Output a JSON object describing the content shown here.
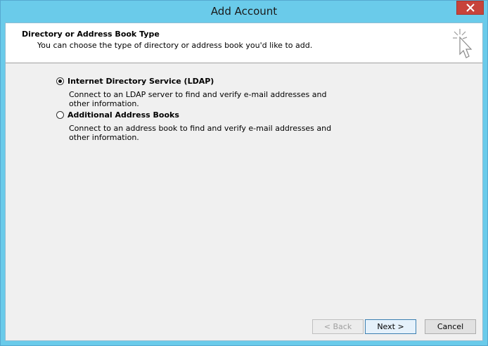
{
  "window": {
    "title": "Add Account"
  },
  "header": {
    "title": "Directory or Address Book Type",
    "subtitle": "You can choose the type of directory or address book you'd like to add."
  },
  "options": [
    {
      "label": "Internet Directory Service (LDAP)",
      "description": "Connect to an LDAP server to find and verify e-mail addresses and other information.",
      "selected": true
    },
    {
      "label": "Additional Address Books",
      "description": "Connect to an address book to find and verify e-mail addresses and other information.",
      "selected": false
    }
  ],
  "buttons": {
    "back": "< Back",
    "next": "Next >",
    "cancel": "Cancel"
  },
  "colors": {
    "titlebar": "#6acbea",
    "close": "#c7433a",
    "panel": "#f0f0f0"
  },
  "icons": {
    "close": "close-icon",
    "wizard": "cursor-sparkle-icon"
  }
}
